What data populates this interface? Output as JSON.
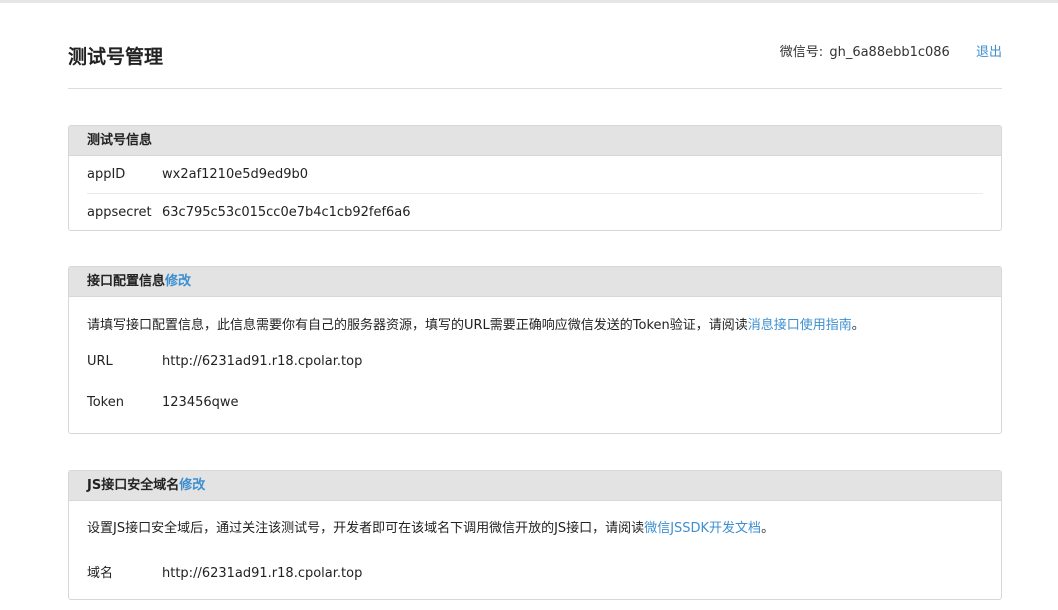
{
  "page": {
    "title": "测试号管理",
    "wechat_id_label": "微信号:",
    "wechat_id": "gh_6a88ebb1c086",
    "logout": "退出"
  },
  "test_account_info": {
    "title": "测试号信息",
    "rows": [
      {
        "label": "appID",
        "value": "wx2af1210e5d9ed9b0"
      },
      {
        "label": "appsecret",
        "value": "63c795c53c015cc0e7b4c1cb92fef6a6"
      }
    ]
  },
  "interface_config": {
    "title": "接口配置信息",
    "edit": "修改",
    "description": "请填写接口配置信息，此信息需要你有自己的服务器资源，填写的URL需要正确响应微信发送的Token验证，请阅读",
    "doc_link": "消息接口使用指南",
    "description_end": "。",
    "rows": [
      {
        "label": "URL",
        "value": "http://6231ad91.r18.cpolar.top"
      },
      {
        "label": "Token",
        "value": "123456qwe"
      }
    ]
  },
  "js_domain": {
    "title": "JS接口安全域名",
    "edit": "修改",
    "description": "设置JS接口安全域后，通过关注该测试号，开发者即可在该域名下调用微信开放的JS接口，请阅读",
    "doc_link": "微信JSSDK开发文档",
    "description_end": "。",
    "rows": [
      {
        "label": "域名",
        "value": "http://6231ad91.r18.cpolar.top"
      }
    ]
  }
}
